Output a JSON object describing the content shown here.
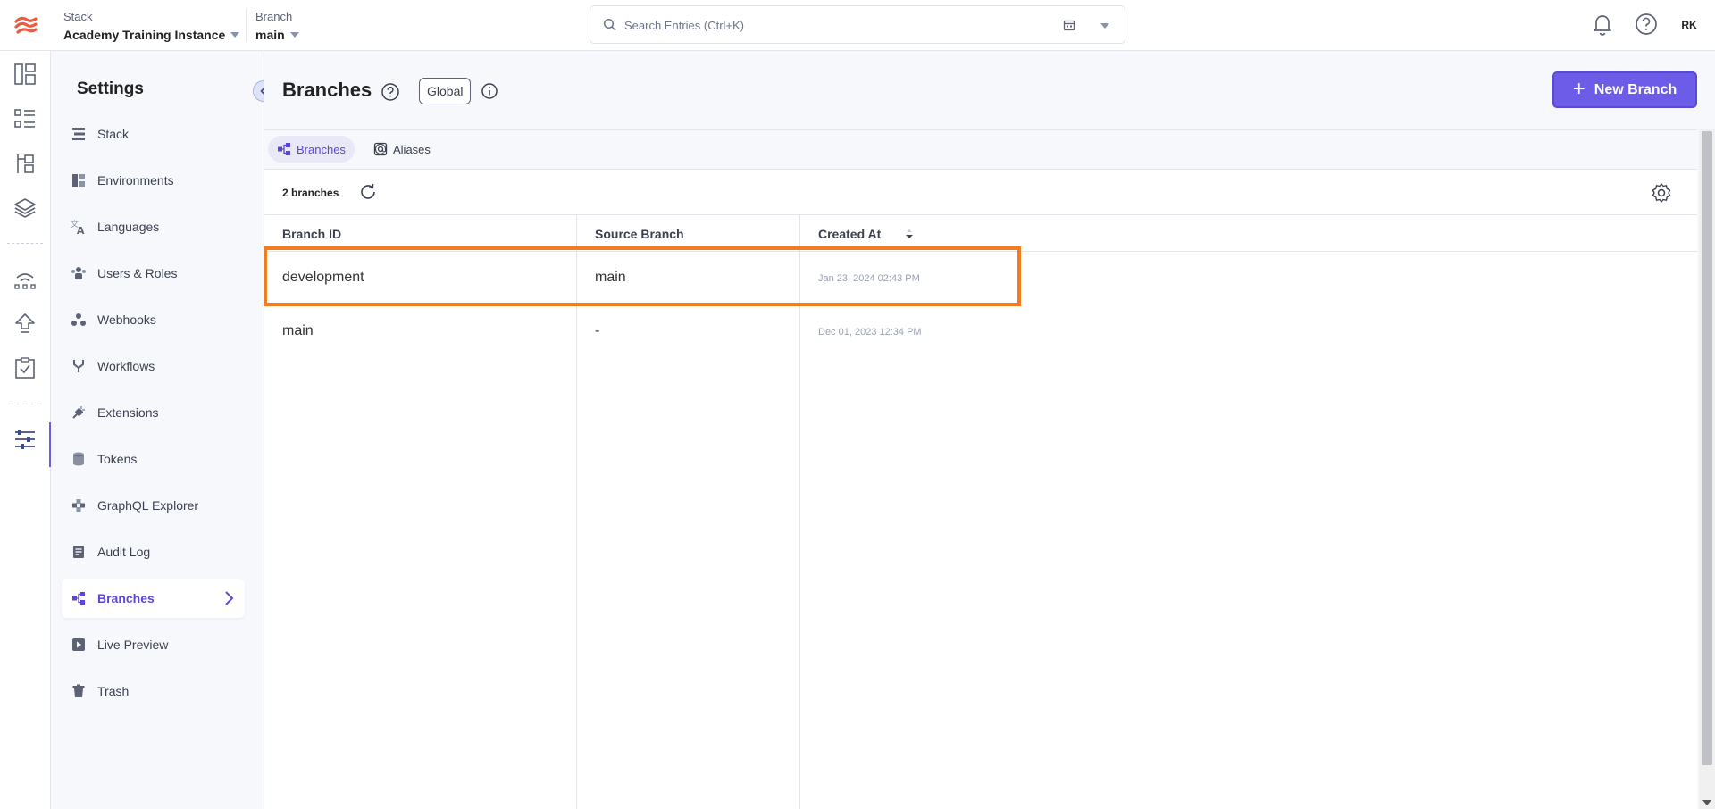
{
  "topbar": {
    "stack_label": "Stack",
    "stack_name": "Academy Training Instance",
    "branch_label": "Branch",
    "branch_name": "main",
    "search_placeholder": "Search Entries (Ctrl+K)",
    "avatar_initials": "RK"
  },
  "settings": {
    "title": "Settings",
    "items": [
      {
        "label": "Stack",
        "icon": "stack-icon"
      },
      {
        "label": "Environments",
        "icon": "environments-icon"
      },
      {
        "label": "Languages",
        "icon": "languages-icon"
      },
      {
        "label": "Users & Roles",
        "icon": "users-icon"
      },
      {
        "label": "Webhooks",
        "icon": "webhooks-icon"
      },
      {
        "label": "Workflows",
        "icon": "workflows-icon"
      },
      {
        "label": "Extensions",
        "icon": "extensions-icon"
      },
      {
        "label": "Tokens",
        "icon": "tokens-icon"
      },
      {
        "label": "GraphQL Explorer",
        "icon": "graphql-icon"
      },
      {
        "label": "Audit Log",
        "icon": "audit-log-icon"
      },
      {
        "label": "Branches",
        "icon": "branches-icon",
        "active": true
      },
      {
        "label": "Live Preview",
        "icon": "live-preview-icon"
      },
      {
        "label": "Trash",
        "icon": "trash-icon"
      }
    ]
  },
  "page": {
    "title": "Branches",
    "badge": "Global",
    "new_button": "New Branch"
  },
  "tabs": [
    {
      "label": "Branches",
      "active": true
    },
    {
      "label": "Aliases",
      "active": false
    }
  ],
  "table": {
    "count_label": "2 branches",
    "columns": [
      "Branch ID",
      "Source Branch",
      "Created At"
    ],
    "rows": [
      {
        "branch_id": "development",
        "source": "main",
        "created_at": "Jan 23, 2024 02:43 PM",
        "highlighted": true
      },
      {
        "branch_id": "main",
        "source": "-",
        "created_at": "Dec 01, 2023 12:34 PM",
        "highlighted": false
      }
    ]
  },
  "colors": {
    "accent": "#6c5ce7",
    "highlight_border": "#f47c20"
  }
}
